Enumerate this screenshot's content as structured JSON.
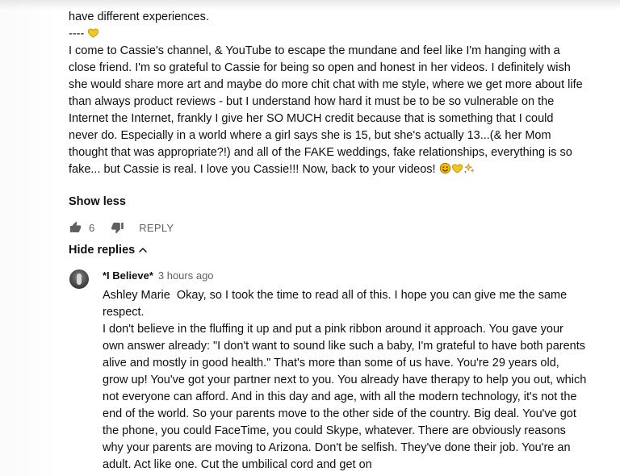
{
  "comment": {
    "lines": {
      "intro": "have different experiences.",
      "dashes": "----"
    },
    "paragraph": "I come to Cassie's channel, & YouTube to escape the mundane and feel like I'm hanging with a close friend. I'm so grateful to Cassie for being so open and honest in her videos. I definitely wish she would share more art and maybe do more chit chat with me style, where we get more about life than always product reviews - but I understand how hard it must be to be so vulnerable on the Internet the Internet, frankly I give her SO MUCH credit because that is something that I could never do. Especially in a world where a girl says she is 15, but she's actually 13...(& her Mom thought that was appropriate?!) and all of the FAKE weddings, fake relationships, everything is so fake... but Cassie is real. I love you Cassie!!! Now, back to your videos!",
    "show_less_label": "Show less",
    "like_count": "6",
    "reply_label": "REPLY",
    "icons": {
      "heart": "yellow-heart-icon",
      "smile": "smiling-face-icon",
      "sparkle": "sparkles-icon",
      "like": "thumbs-up-icon",
      "dislike": "thumbs-down-icon"
    },
    "colors": {
      "heart": "#f2c81e",
      "smile": "#f5b800",
      "sparkle": "#f6c342"
    }
  },
  "thread": {
    "hide_replies_label": "Hide replies",
    "reply": {
      "author": "*I Believe*",
      "time": "3 hours ago",
      "mention": "Ashley Marie",
      "first_line": "Okay, so I took the time to read all of this. I hope you can give me the same respect.",
      "second_para": "I don't believe in the fluffing it up and put a pink ribbon around it approach. You gave your own answer already: \"I don't want to sound like such a baby, I'm grateful to have both parents alive and mostly in good health.\" That's more than some of us have. You're 29 years old, grow up! You've got your partner next to you. You already have therapy to help you out, which not everyone can afford. And in this day and age, with all the modern technology, it's not the end of the world. So your parents move to the other side of the country. Big deal. You've got the phone, you could FaceTime, you could Skype, whatever. There are obviously reasons why your parents are moving to Arizona. Don't be selfish. They've done their job. You're an adult. Act like one. Cut the umbilical cord and get on"
    }
  },
  "ui": {
    "text_color": "#0f0f0f",
    "secondary_text_color": "#606060"
  }
}
